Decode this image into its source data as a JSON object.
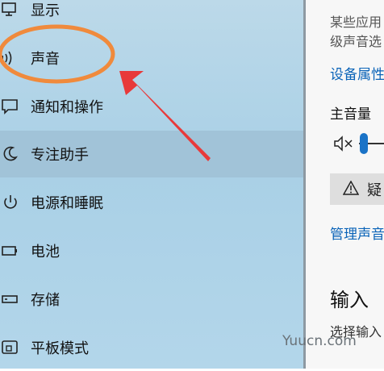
{
  "sidebar": {
    "items": [
      {
        "label": "显示",
        "icon": "monitor-icon"
      },
      {
        "label": "声音",
        "icon": "speaker-icon"
      },
      {
        "label": "通知和操作",
        "icon": "notification-icon"
      },
      {
        "label": "专注助手",
        "icon": "moon-icon",
        "selected": true
      },
      {
        "label": "电源和睡眠",
        "icon": "power-icon"
      },
      {
        "label": "电池",
        "icon": "battery-icon"
      },
      {
        "label": "存储",
        "icon": "storage-icon"
      },
      {
        "label": "平板模式",
        "icon": "tablet-icon"
      }
    ]
  },
  "content": {
    "desc_line1": "某些应用",
    "desc_line2": "级声音选",
    "device_properties_link": "设备属性",
    "master_volume_label": "主音量",
    "volume_level": 0.05,
    "troubleshoot_label": "疑",
    "manage_sound_link": "管理声音",
    "input_heading": "输入",
    "input_cut_text": "选择输入"
  },
  "annotation": {
    "circle_color": "#f08a3c",
    "arrow_color": "#e8393a"
  },
  "watermark": "Yuucn.com"
}
